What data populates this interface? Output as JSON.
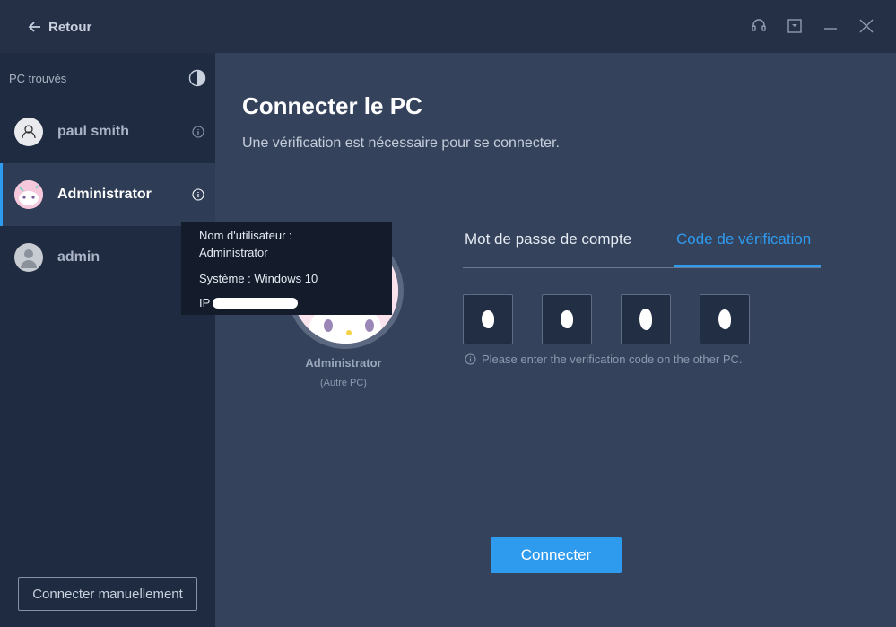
{
  "titlebar": {
    "back_label": "Retour"
  },
  "sidebar": {
    "header": "PC trouvés",
    "items": [
      {
        "name": "paul smith"
      },
      {
        "name": "Administrator"
      },
      {
        "name": "admin"
      }
    ],
    "manual_button": "Connecter manuellement"
  },
  "main": {
    "title": "Connecter le PC",
    "subtitle": "Une vérification est nécessaire pour se connecter.",
    "target": {
      "name": "Administrator",
      "kind": "(Autre PC)"
    },
    "tabs": [
      "Mot de passe de compte",
      "Code de vérification"
    ],
    "active_tab": "Code de vérification",
    "hint": "Please enter the verification code on the other PC.",
    "connect_button": "Connecter"
  },
  "tooltip": {
    "username_label": "Nom d'utilisateur :",
    "username_value": "Administrator",
    "system": "Système : Windows 10",
    "ip_label": "IP :"
  },
  "colors": {
    "accent": "#2f9bef",
    "sidebar_bg": "#1f2b40",
    "main_bg": "#34425c",
    "titlebar_bg": "#253047"
  }
}
